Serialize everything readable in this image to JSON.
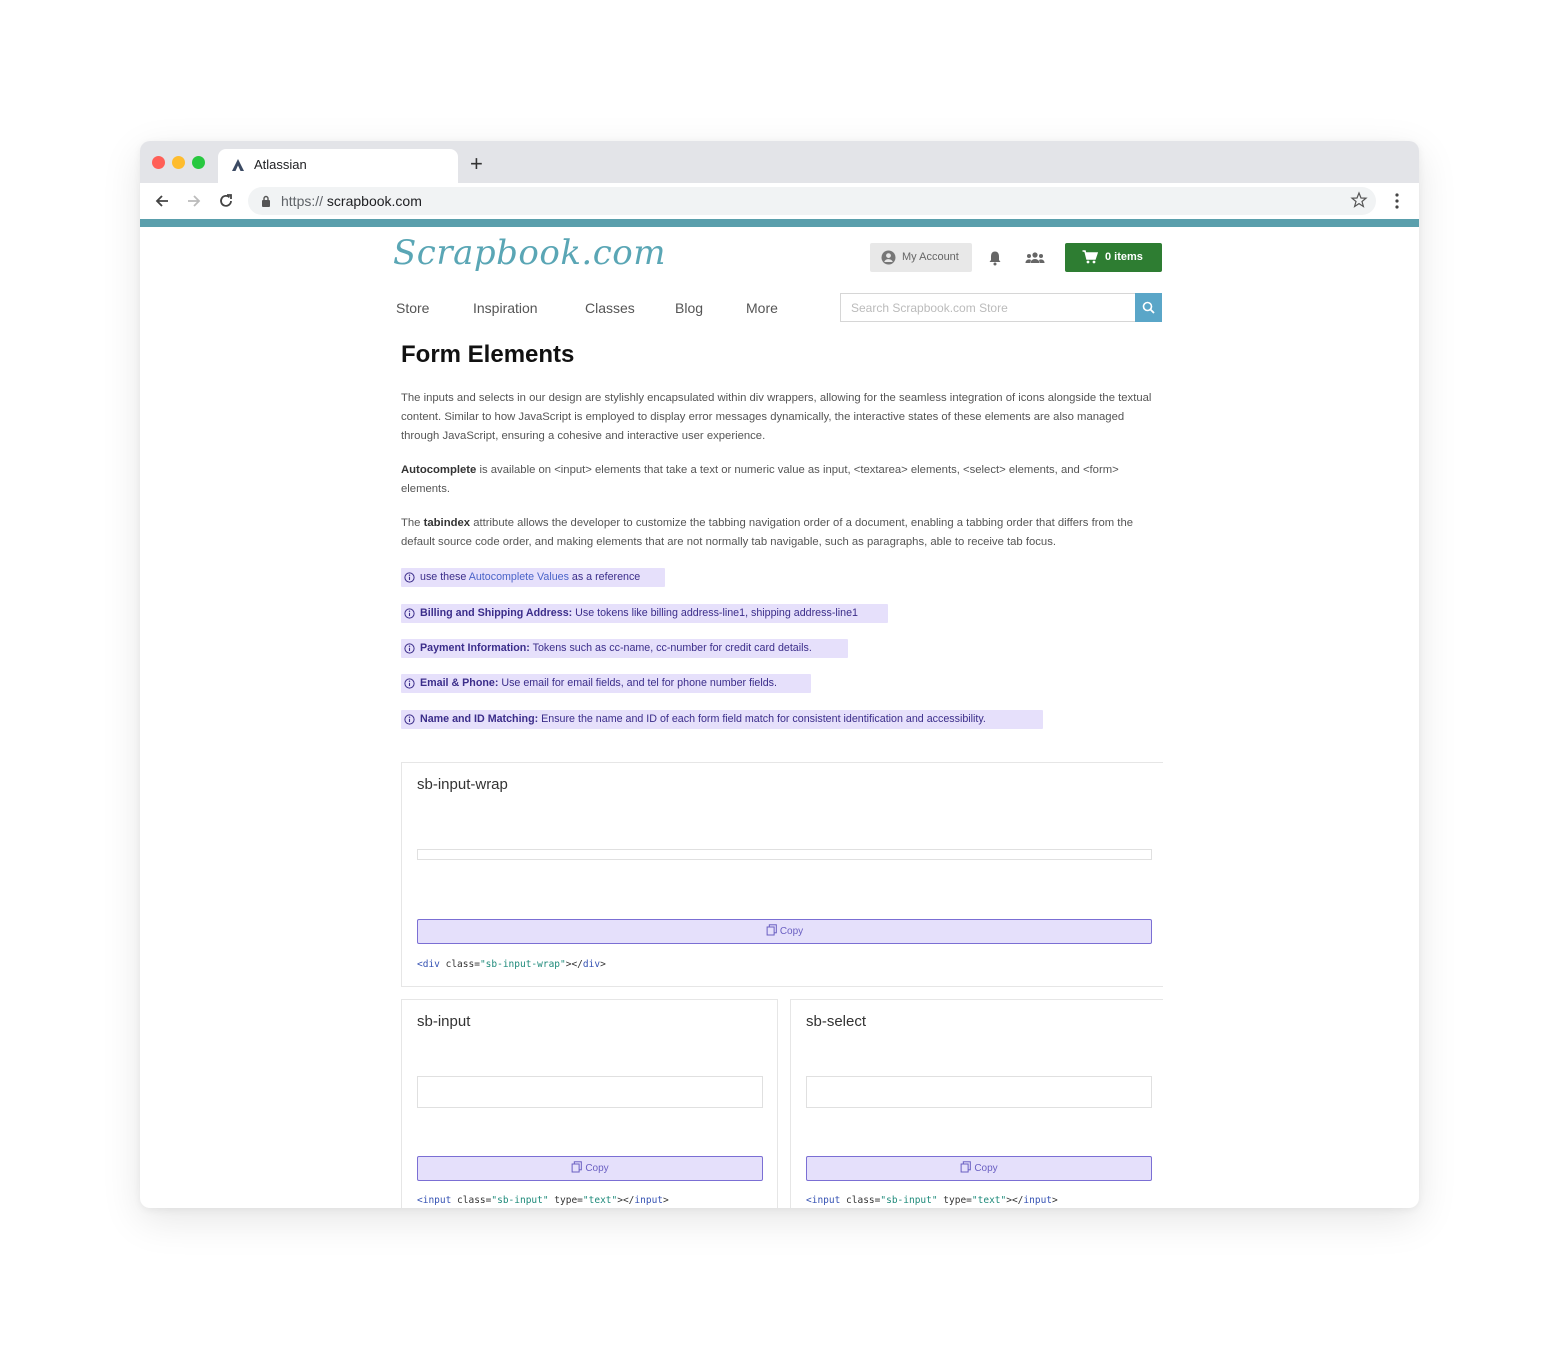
{
  "browser": {
    "tab_title": "Atlassian",
    "new_tab_symbol": "+",
    "url_scheme": "https://",
    "url_host": "scrapbook.com"
  },
  "header": {
    "logo_text": "Scrapbook.com",
    "account_label": "My Account",
    "cart_label": "0 items",
    "nav": [
      "Store",
      "Inspiration",
      "Classes",
      "Blog",
      "More"
    ],
    "search_placeholder": "Search Scrapbook.com Store"
  },
  "content": {
    "title": "Form Elements",
    "intro": "The inputs and selects in our design are stylishly encapsulated within div wrappers, allowing for the seamless integration of icons alongside the textual content. Similar to how JavaScript is employed to display error messages dynamically, the interactive states of these elements are also managed through JavaScript, ensuring a cohesive and interactive user experience.",
    "autocomplete_term": "Autocomplete",
    "autocomplete_text": " is available on <input> elements that take a text or numeric value as input, <textarea> elements, <select> elements, and <form> elements.",
    "tabindex_prefix": "The ",
    "tabindex_term": "tabindex",
    "tabindex_text": " attribute allows the developer to customize the tabbing navigation order of a document, enabling a tabbing order that differs from the default source code order, and making elements that are not normally tab navigable, such as paragraphs, able to receive tab focus.",
    "notes": {
      "ref_pre": "use these ",
      "ref_link": "Autocomplete Values",
      "ref_post": " as a reference",
      "billing_label": "Billing and Shipping Address:",
      "billing_text": " Use tokens like billing address-line1, shipping address-line1",
      "payment_label": "Payment Information:",
      "payment_text": " Tokens such as cc-name, cc-number for credit card details.",
      "email_label": "Email & Phone:",
      "email_text": " Use email for email fields, and tel for phone number fields.",
      "name_label": "Name and ID Matching:",
      "name_text": " Ensure the name and ID of each form field match for consistent identification and accessibility."
    }
  },
  "cards": {
    "wrap": {
      "title": "sb-input-wrap",
      "copy_label": "Copy",
      "code": {
        "open_tag": "<div",
        "attr": " class=",
        "val": "\"sb-input-wrap\"",
        "close": "></",
        "close_tag": "div",
        "end": ">"
      }
    },
    "input": {
      "title": "sb-input",
      "copy_label": "Copy",
      "code": {
        "open_tag": "<input",
        "attr1": " class=",
        "val1": "\"sb-input\"",
        "attr2": " type=",
        "val2": "\"text\"",
        "close": "></",
        "close_tag": "input",
        "end": ">"
      }
    },
    "select": {
      "title": "sb-select",
      "copy_label": "Copy",
      "code": {
        "open_tag": "<input",
        "attr1": " class=",
        "val1": "\"sb-input\"",
        "attr2": " type=",
        "val2": "\"text\"",
        "close": "></",
        "close_tag": "input",
        "end": ">"
      }
    }
  },
  "colors": {
    "accent": "#5a9fac",
    "cart_green": "#2e7d32",
    "note_bg": "#e6e0fb",
    "copy_border": "#7b6fd4"
  }
}
